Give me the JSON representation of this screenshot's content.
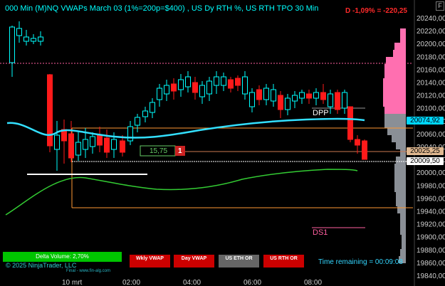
{
  "header": {
    "title": "000 Min (M)NQ VWAPs March 03 (1%=200p=$400) , US Dy RTH %, US RTH TPO 30 Min",
    "daily_change": "D -1,09% = -220,25",
    "f_button": "F"
  },
  "price_axis": {
    "labels": [
      "20240,00",
      "20220,00",
      "20200,00",
      "20180,00",
      "20160,00",
      "20140,00",
      "20120,00",
      "20100,00",
      "20080,00",
      "20060,00",
      "20040,00",
      "20020,00",
      "20000,00",
      "19980,00",
      "19960,00",
      "19940,00",
      "19920,00",
      "19900,00",
      "19880,00",
      "19860,00",
      "19840,00"
    ],
    "tags": {
      "vwap": "20074,92",
      "level": "20025,25",
      "last": "20009,50"
    }
  },
  "time_axis": [
    "10 mrt",
    "02:00",
    "04:00",
    "06:00",
    "08:00"
  ],
  "chart_annotations": {
    "dpp": "DPP",
    "ds1": "DS1",
    "trade_qty": "15,75",
    "trade_count": "1"
  },
  "controls": {
    "delta_volume": "Delta Volume: 2,70%",
    "wkly_vwap": "Wkly VWAP",
    "day_vwap": "Day VWAP",
    "us_eth_or": "US ETH OR",
    "us_rth_or": "US RTH OR"
  },
  "footer": {
    "copyright": "© 2025 NinjaTrader, LLC",
    "finaln": "Final - www.fin-alg.com",
    "time_remaining": "Time remaining = 00:09:08"
  },
  "colors": {
    "up_candle": "#00ffff",
    "down_candle": "#ff1a1a",
    "vwap_line": "#33e0ff",
    "lower_band": "#33cc33",
    "or_line": "#ff9933",
    "profile_pink": "#ff6fb0",
    "profile_gray": "#8a8f96",
    "delta_green": "#00c400",
    "button_red": "#cc0000",
    "button_gray": "#666666"
  }
}
